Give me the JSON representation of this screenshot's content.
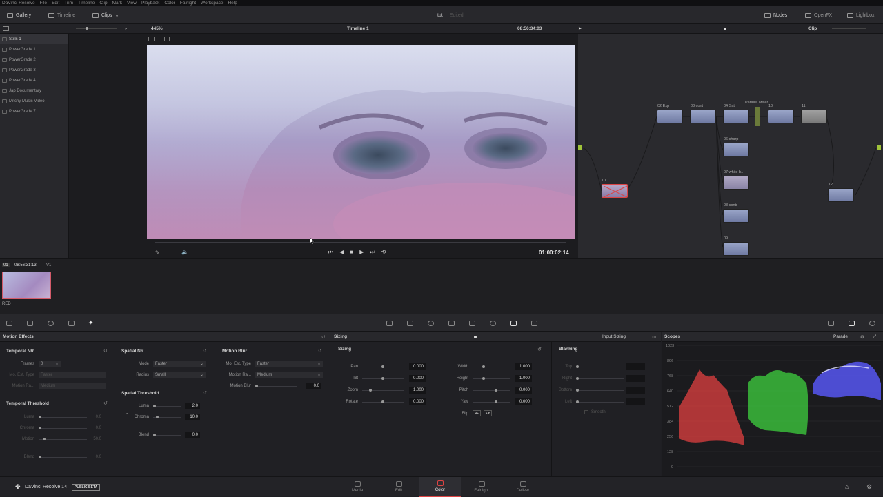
{
  "menu": [
    "DaVinci Resolve",
    "File",
    "Edit",
    "Trim",
    "Timeline",
    "Clip",
    "Mark",
    "View",
    "Playback",
    "Color",
    "Fairlight",
    "Workspace",
    "Help"
  ],
  "topbar": {
    "gallery": "Gallery",
    "timeline": "Timeline",
    "clips": "Clips",
    "project": "tut",
    "status": "Edited",
    "nodes": "Nodes",
    "openfx": "OpenFX",
    "lightbox": "Lightbox"
  },
  "subbar": {
    "zoom": "445%",
    "timeline_name": "Timeline 1",
    "timecode": "08:56:34:03",
    "clip_mode": "Clip"
  },
  "gallery": {
    "items": [
      "Stills 1",
      "PowerGrade 1",
      "PowerGrade 2",
      "PowerGrade 3",
      "PowerGrade 4",
      "Jap Documentary",
      "Mitchy Music Video",
      "PowerGrade 7"
    ]
  },
  "viewer": {
    "timecode": "01:00:02:14",
    "scrub_position": 0.38
  },
  "node_graph": {
    "nodes": [
      {
        "id": "01",
        "label": "01"
      },
      {
        "id": "02",
        "label": "02 Exp"
      },
      {
        "id": "03",
        "label": "03 cont"
      },
      {
        "id": "04",
        "label": "04 Sat"
      },
      {
        "id": "10",
        "label": "10"
      },
      {
        "id": "11",
        "label": "11"
      },
      {
        "id": "05",
        "label": "06 sharp"
      },
      {
        "id": "07",
        "label": "07 white b.."
      },
      {
        "id": "08",
        "label": "08 contr"
      },
      {
        "id": "09",
        "label": "09"
      },
      {
        "id": "12",
        "label": "12"
      }
    ],
    "parallel_label": "Parallel Mixer"
  },
  "clips": {
    "index": "01",
    "timecode": "08:56:31:13",
    "track": "V1",
    "codec": "RED"
  },
  "motion_effects": {
    "title": "Motion Effects",
    "temporal_nr": {
      "title": "Temporal NR",
      "frames_label": "Frames",
      "frames": "0",
      "mo_est_label": "Mo. Est. Type",
      "mo_est": "Faster",
      "motion_range_label": "Motion Ra...",
      "motion_range": "Medium"
    },
    "temporal_threshold": {
      "title": "Temporal Threshold",
      "luma_label": "Luma",
      "luma": "0.0",
      "chroma_label": "Chroma",
      "chroma": "0.0",
      "motion_label": "Motion",
      "motion": "50.0",
      "blend_label": "Blend",
      "blend": "0.0"
    },
    "spatial_nr": {
      "title": "Spatial NR",
      "mode_label": "Mode",
      "mode": "Faster",
      "radius_label": "Radius",
      "radius": "Small"
    },
    "spatial_threshold": {
      "title": "Spatial Threshold",
      "luma_label": "Luma",
      "luma": "2.0",
      "chroma_label": "Chroma",
      "chroma": "10.0",
      "blend_label": "Blend",
      "blend": "0.0"
    },
    "motion_blur": {
      "title": "Motion Blur",
      "mo_est_label": "Mo. Est. Type",
      "mo_est": "Faster",
      "motion_range_label": "Motion Ra...",
      "motion_range": "Medium",
      "blur_label": "Motion Blur",
      "blur": "0.0"
    }
  },
  "sizing": {
    "title": "Sizing",
    "mode": "Input Sizing",
    "section": "Sizing",
    "pan_label": "Pan",
    "pan": "0.000",
    "tilt_label": "Tilt",
    "tilt": "0.000",
    "zoom_label": "Zoom",
    "zoom": "1.000",
    "rotate_label": "Rotate",
    "rotate": "0.000",
    "width_label": "Width",
    "width": "1.000",
    "height_label": "Height",
    "height": "1.000",
    "pitch_label": "Pitch",
    "pitch": "0.000",
    "yaw_label": "Yaw",
    "yaw": "0.000",
    "flip_label": "Flip",
    "blanking": {
      "title": "Blanking",
      "top": "Top",
      "right": "Right",
      "bottom": "Bottom",
      "left": "Left",
      "smooth": "Smooth"
    }
  },
  "scopes": {
    "title": "Scopes",
    "mode": "Parade",
    "ticks": [
      "1023",
      "896",
      "768",
      "640",
      "512",
      "384",
      "256",
      "128",
      "0"
    ]
  },
  "bottom": {
    "app": "DaVinci Resolve 14",
    "badge": "PUBLIC BETA",
    "pages": [
      {
        "label": "Media"
      },
      {
        "label": "Edit"
      },
      {
        "label": "Color"
      },
      {
        "label": "Fairlight"
      },
      {
        "label": "Deliver"
      }
    ],
    "active_page": "Color"
  }
}
